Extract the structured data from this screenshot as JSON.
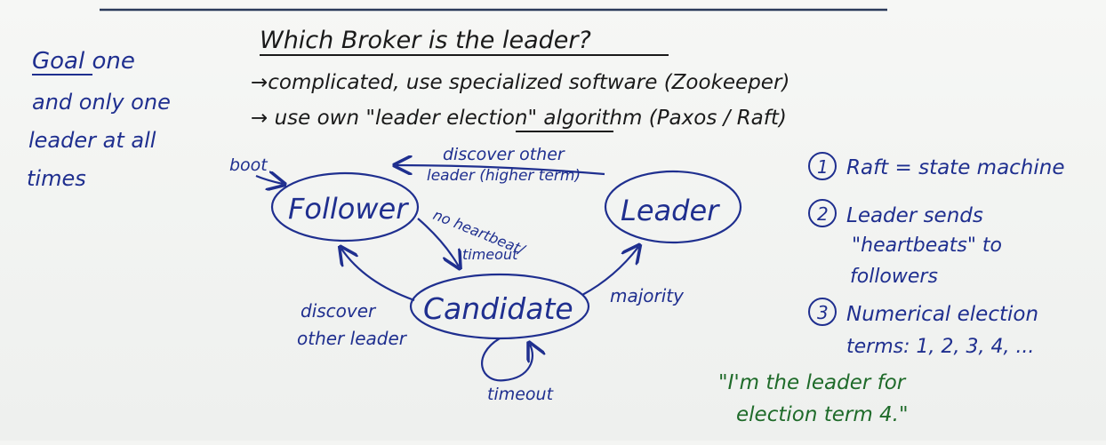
{
  "colors": {
    "board": "#f4f5f3",
    "ink_black": "#1a1a1a",
    "ink_blue": "#1f2f8f",
    "ink_green": "#1f6b2a"
  },
  "left_note": {
    "line1": "Goal one",
    "line2": "and only one",
    "line3": "leader at all",
    "line4": "times"
  },
  "top": {
    "title": "Which Broker is the leader?",
    "line1": "→complicated, use specialized software (Zookeeper)",
    "line2_prefix": "→ use own \"leader ",
    "line2_emph": "election",
    "line2_suffix": "\" algorithm (Paxos / Raft)"
  },
  "states": {
    "follower": "Follower",
    "leader": "Leader",
    "candidate": "Candidate"
  },
  "transitions": {
    "boot": "boot",
    "discover_line1": "discover other",
    "discover_line2": "leader (higher term)",
    "no_heartbeat_line1": "no heartbeat/",
    "no_heartbeat_line2": "timeout",
    "majority": "majority",
    "discover_other_line1": "discover",
    "discover_other_line2": "other leader",
    "timeout": "timeout"
  },
  "right_notes": {
    "n1_num": "1",
    "n1_text": "Raft = state machine",
    "n2_num": "2",
    "n2_line1": "Leader sends",
    "n2_line2": "\"heartbeats\" to",
    "n2_line3": "followers",
    "n3_num": "3",
    "n3_line1": "Numerical election",
    "n3_line2": "terms: 1, 2, 3, 4, ..."
  },
  "quote": {
    "line1": "\"I'm the leader for",
    "line2": "election term 4.\""
  }
}
